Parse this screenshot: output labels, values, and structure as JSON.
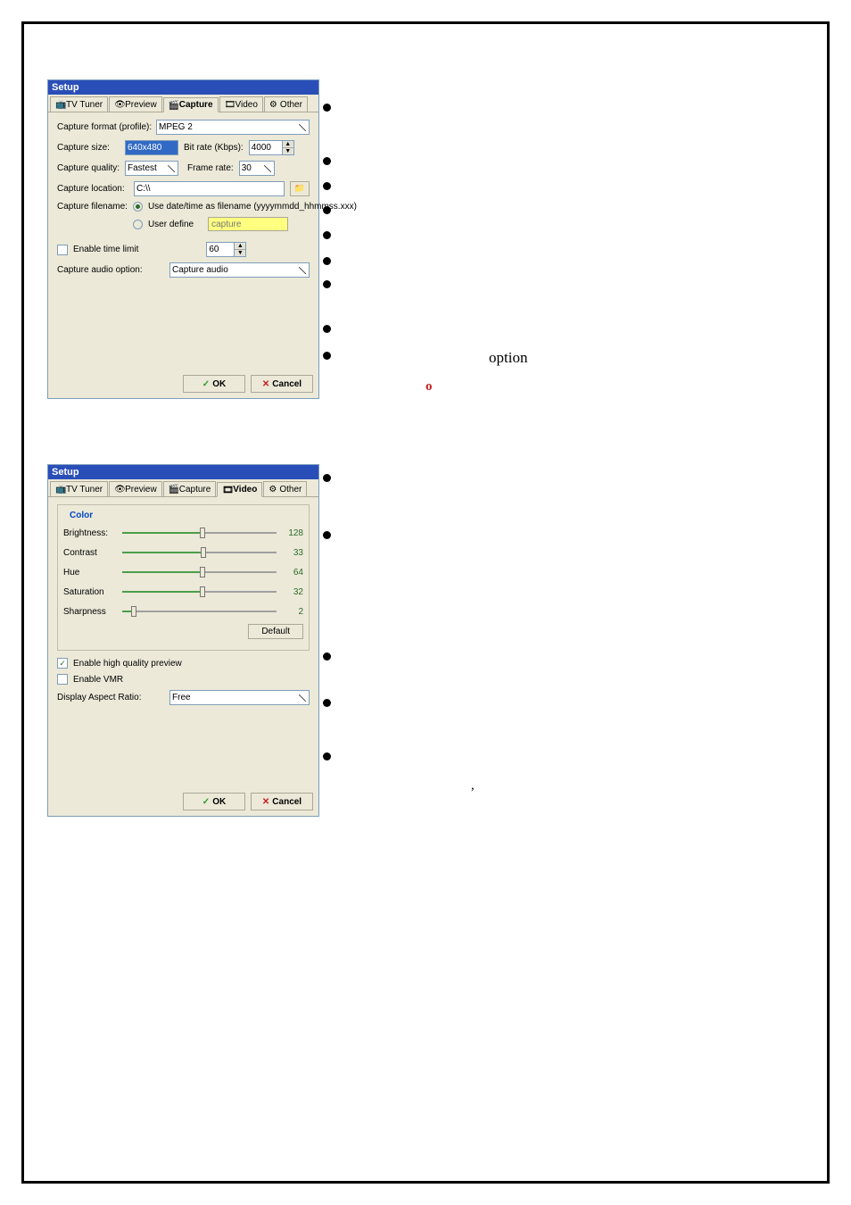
{
  "dialog_title": "Setup",
  "tabs": {
    "tv": "TV Tuner",
    "preview": "Preview",
    "capture": "Capture",
    "video": "Video",
    "other": "Other"
  },
  "capture": {
    "format_label": "Capture format (profile):",
    "format_value": "MPEG 2",
    "size_label": "Capture size:",
    "size_value": "640x480",
    "bitrate_label": "Bit rate (Kbps):",
    "bitrate_value": "4000",
    "quality_label": "Capture quality:",
    "quality_value": "Fastest",
    "framerate_label": "Frame rate:",
    "framerate_value": "30",
    "location_label": "Capture location:",
    "location_value": "C:\\\\",
    "filename_label": "Capture filename:",
    "filename_opt1": "Use date/time as filename (yyyymmdd_hhmmss.xxx)",
    "filename_opt2": "User define",
    "filename_user_value": "capture",
    "timelimit_label": "Enable time limit",
    "timelimit_value": "60",
    "audio_label": "Capture audio option:",
    "audio_value": "Capture audio"
  },
  "video": {
    "color_title": "Color",
    "brightness_label": "Brightness:",
    "brightness_value": 128,
    "brightness_max": 256,
    "contrast_label": "Contrast",
    "contrast_value": 33,
    "contrast_max": 64,
    "hue_label": "Hue",
    "hue_value": 64,
    "hue_max": 128,
    "saturation_label": "Saturation",
    "saturation_value": 32,
    "saturation_max": 64,
    "sharpness_label": "Sharpness",
    "sharpness_value": 2,
    "sharpness_max": 32,
    "default_btn": "Default",
    "hq_preview": "Enable high quality preview",
    "enable_vmr": "Enable VMR",
    "aspect_label": "Display Aspect Ratio:",
    "aspect_value": "Free"
  },
  "buttons": {
    "ok": "OK",
    "cancel": "Cancel"
  },
  "annotations": {
    "option": "option",
    "o": "o",
    "comma": ","
  }
}
